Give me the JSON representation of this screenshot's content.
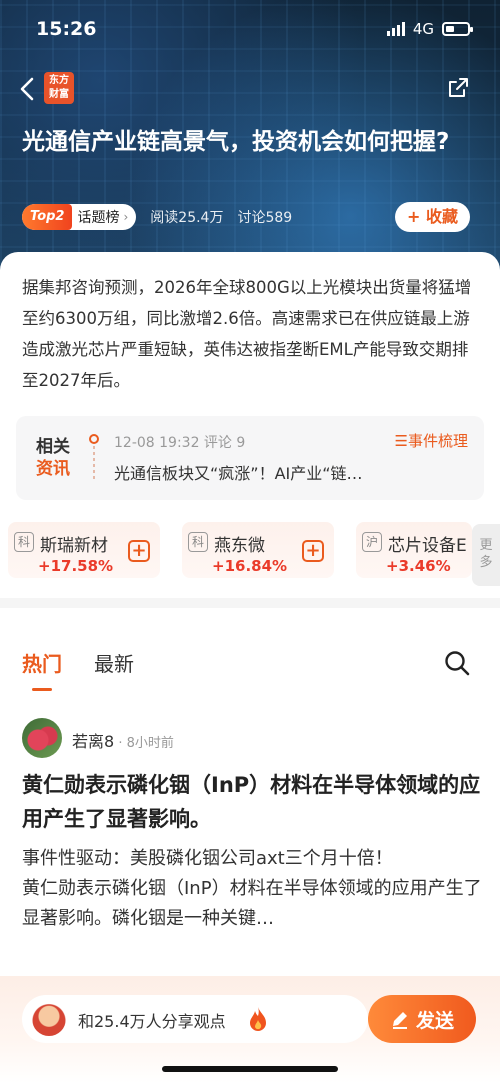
{
  "status_bar": {
    "time": "15:26",
    "network": "4G"
  },
  "header": {
    "logo_text": "东方财富",
    "logo_line1": "东方",
    "logo_line2": "财富"
  },
  "topic": {
    "title": "光通信产业链高景气，投资机会如何把握?",
    "rank_badge": "Top2",
    "rank_label": "话题榜",
    "reads": "阅读25.4万",
    "discussions": "讨论589",
    "favorite_label": "+ 收藏"
  },
  "summary": "据集邦咨询预测，2026年全球800G以上光模块出货量将猛增至约6300万组，同比激增2.6倍。高速需求已在供应链最上游造成激光芯片严重短缺，英伟达被指垄断EML产能导致交期排至2027年后。",
  "related": {
    "tag_line1": "相关",
    "tag_line2": "资讯",
    "datetime": "12-08 19:32  评论 9",
    "event_label": "☰事件梳理",
    "headline": "光通信板块又“疯涨”！AI产业“链…"
  },
  "stocks": [
    {
      "market": "科",
      "name": "斯瑞新材",
      "change": "+17.58%"
    },
    {
      "market": "科",
      "name": "燕东微",
      "change": "+16.84%"
    },
    {
      "market": "沪",
      "name": "芯片设备E",
      "change": "+3.46%"
    }
  ],
  "more_label": {
    "line1": "更",
    "line2": "多"
  },
  "tabs": {
    "hot": "热门",
    "latest": "最新"
  },
  "post": {
    "author": "若离8",
    "time": " · 8小时前",
    "title": "黄仁勋表示磷化铟（InP）材料在半导体领域的应用产生了显著影响。",
    "body_line1": "事件性驱动：美股磷化铟公司axt三个月十倍！",
    "body_line2": "黄仁勋表示磷化铟（InP）材料在半导体领域的应用产生了显著影响。磷化铟是一种关键…"
  },
  "bottom": {
    "comment_placeholder": "和25.4万人分享观点",
    "post_label": "发送"
  },
  "colors": {
    "accent": "#ea5b1e",
    "rise": "#ea3b2a"
  }
}
